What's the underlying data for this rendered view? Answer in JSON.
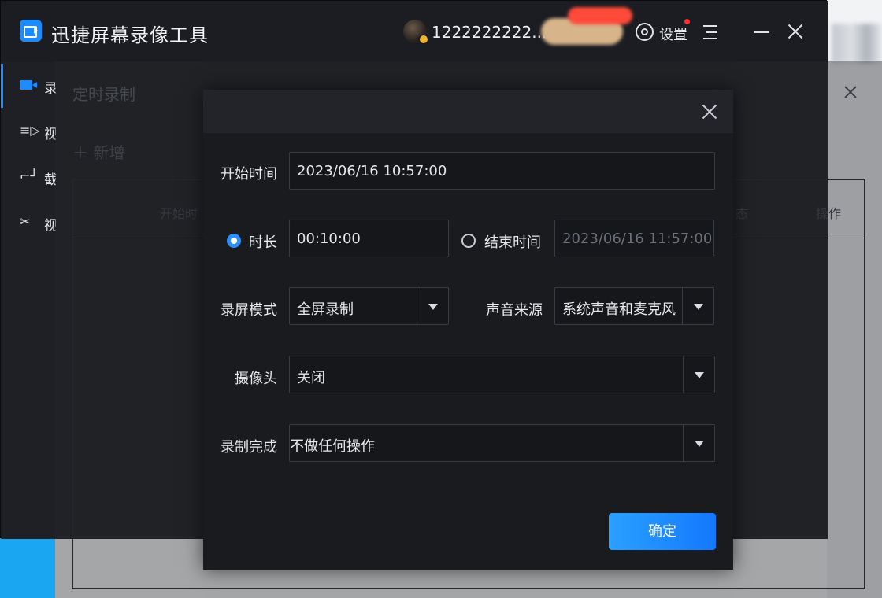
{
  "app": {
    "title": "迅捷屏幕录像工具"
  },
  "user": {
    "name": "1222222222..."
  },
  "header": {
    "settings_label": "设置"
  },
  "sidebar": {
    "items": [
      {
        "label": "录",
        "icon": "video-camera-icon",
        "active": true
      },
      {
        "label": "视",
        "icon": "video-edit-icon"
      },
      {
        "label": "截",
        "icon": "screenshot-icon"
      },
      {
        "label": "视",
        "icon": "video-tools-icon"
      }
    ]
  },
  "background_panel": {
    "title": "定时录制",
    "add_label": "新增",
    "columns": [
      "开始时",
      "态",
      "操作"
    ]
  },
  "dialog": {
    "start_time_label": "开始时间",
    "start_time_value": "2023/06/16 10:57:00",
    "duration_label": "时长",
    "duration_value": "00:10:00",
    "duration_selected": true,
    "end_time_label": "结束时间",
    "end_time_value": "2023/06/16 11:57:00",
    "end_time_selected": false,
    "record_mode_label": "录屏模式",
    "record_mode_value": "全屏录制",
    "audio_source_label": "声音来源",
    "audio_source_value": "系统声音和麦克风",
    "camera_label": "摄像头",
    "camera_value": "关闭",
    "on_complete_label": "录制完成",
    "on_complete_value": "不做任何操作",
    "confirm_label": "确定"
  },
  "colors": {
    "accent": "#1e8bff",
    "window_bg": "#16171b",
    "dialog_bg": "#1a1b1f",
    "notify": "#ff2d2d"
  }
}
